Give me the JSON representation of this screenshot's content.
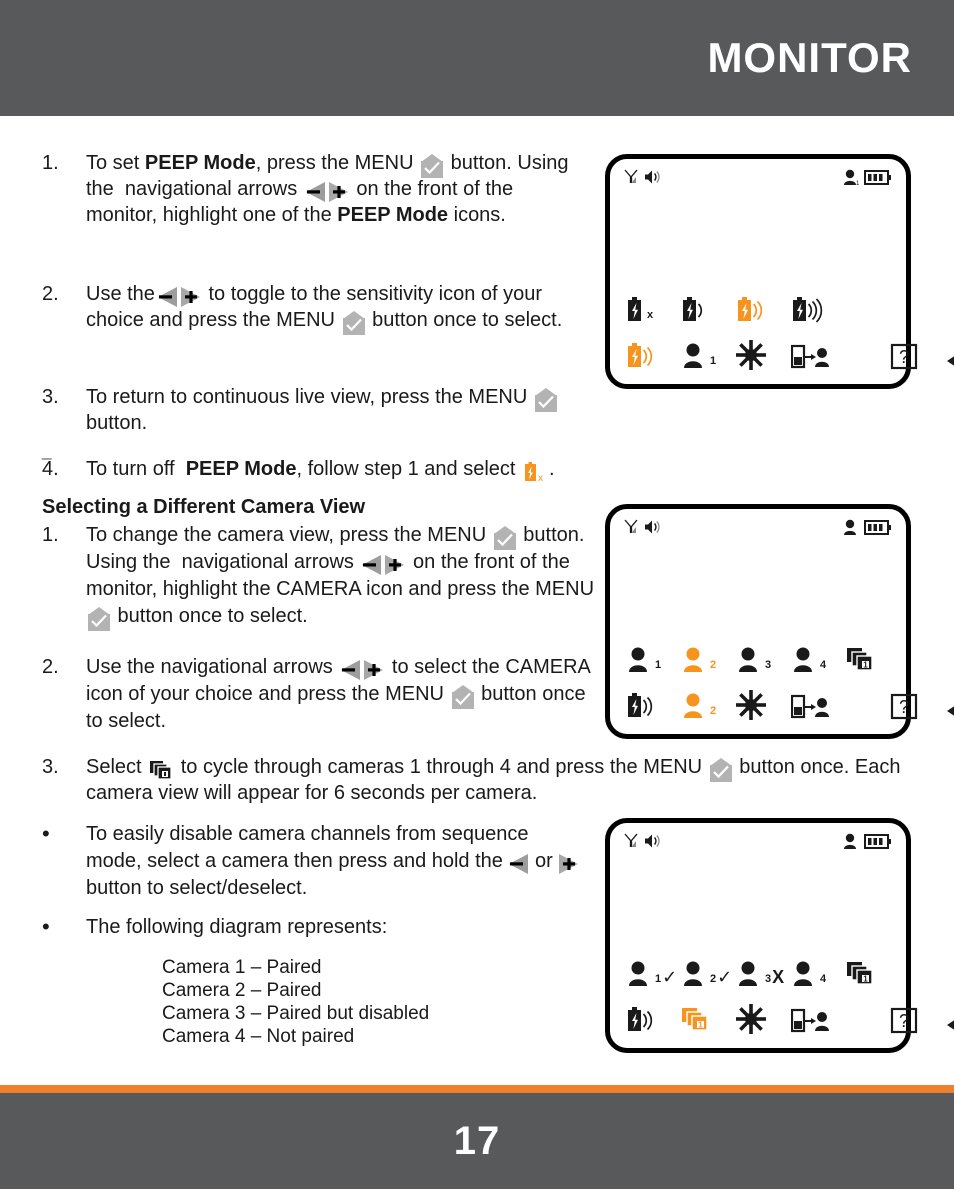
{
  "header": {
    "title": "MONITOR"
  },
  "footer": {
    "page_number": "17"
  },
  "colors": {
    "header_gray": "#58595b",
    "accent_orange": "#f07f2b",
    "icon_orange": "#f7941e",
    "icon_gray": "#b3b3b3",
    "black": "#000000"
  },
  "peep_section": {
    "steps": [
      {
        "marker": "1.",
        "parts": [
          {
            "t": "text",
            "v": "To set "
          },
          {
            "t": "bold",
            "v": "PEEP Mode"
          },
          {
            "t": "text",
            "v": ", press the MENU "
          },
          {
            "t": "icon",
            "v": "menu-check-icon"
          },
          {
            "t": "text",
            "v": " button. Using the  navigational arrows "
          },
          {
            "t": "icon",
            "v": "nav-arrows-icon"
          },
          {
            "t": "text",
            "v": " on the front of the monitor, highlight one of the "
          },
          {
            "t": "bold",
            "v": "PEEP Mode"
          },
          {
            "t": "text",
            "v": " icons."
          }
        ]
      },
      {
        "marker": "2.",
        "parts": [
          {
            "t": "text",
            "v": "Use the"
          },
          {
            "t": "icon",
            "v": "nav-arrows-icon"
          },
          {
            "t": "text",
            "v": " to toggle to the sensitivity icon of your choice and press the MENU "
          },
          {
            "t": "icon",
            "v": "menu-check-icon"
          },
          {
            "t": "text",
            "v": " button once to select."
          }
        ]
      },
      {
        "marker": "3.",
        "parts": [
          {
            "t": "text",
            "v": "To return to continuous live view, press the MENU "
          },
          {
            "t": "icon",
            "v": "menu-check-icon"
          },
          {
            "t": "text",
            "v": " button."
          }
        ]
      },
      {
        "marker": "4.",
        "parts": [
          {
            "t": "text",
            "v": "To turn off  "
          },
          {
            "t": "bold",
            "v": "PEEP Mode"
          },
          {
            "t": "text",
            "v": ", follow step 1 and select "
          },
          {
            "t": "icon",
            "v": "peep-off-battery-icon"
          },
          {
            "t": "text",
            "v": "."
          }
        ]
      }
    ],
    "stray_dash": "_"
  },
  "camera_section": {
    "heading": "Selecting a Different Camera View",
    "steps": [
      {
        "marker": "1.",
        "parts": [
          {
            "t": "text",
            "v": "To change the camera view, press the MENU "
          },
          {
            "t": "icon",
            "v": "menu-check-icon"
          },
          {
            "t": "text",
            "v": " button.  Using the  navigational arrows "
          },
          {
            "t": "icon",
            "v": "nav-arrows-icon"
          },
          {
            "t": "text",
            "v": " on the front of the monitor, highlight the CAMERA icon and press the MENU "
          },
          {
            "t": "icon",
            "v": "menu-check-icon"
          },
          {
            "t": "text",
            "v": " button once to select."
          }
        ]
      },
      {
        "marker": "2.",
        "parts": [
          {
            "t": "text",
            "v": "Use the navigational arrows "
          },
          {
            "t": "icon",
            "v": "nav-arrows-icon"
          },
          {
            "t": "text",
            "v": " to select the CAMERA icon of your choice and press the MENU "
          },
          {
            "t": "icon",
            "v": "menu-check-icon"
          },
          {
            "t": "text",
            "v": " button once to select."
          }
        ]
      },
      {
        "marker": "3.",
        "parts": [
          {
            "t": "text",
            "v": "Select "
          },
          {
            "t": "icon",
            "v": "sequence-icon"
          },
          {
            "t": "text",
            "v": " to cycle through cameras 1 through 4 and press the MENU "
          },
          {
            "t": "icon",
            "v": "menu-check-icon"
          },
          {
            "t": "text",
            "v": " button once. Each camera view will appear for 6 seconds per camera."
          }
        ]
      }
    ],
    "bullets": [
      {
        "marker": "•",
        "parts": [
          {
            "t": "text",
            "v": "To easily disable camera channels from sequence mode, select a camera then press and hold the "
          },
          {
            "t": "icon",
            "v": "arrow-left-icon"
          },
          {
            "t": "text",
            "v": " or "
          },
          {
            "t": "icon",
            "v": "arrow-right-icon"
          },
          {
            "t": "text",
            "v": " button to select/deselect."
          }
        ]
      },
      {
        "marker": "•",
        "parts": [
          {
            "t": "text",
            "v": "The following diagram represents:"
          }
        ]
      }
    ],
    "diagram_legend": [
      "Camera 1 – Paired",
      "Camera 2 – Paired",
      "Camera 3 – Paired but disabled",
      "Camera 4 – Not paired"
    ]
  },
  "monitors": [
    {
      "name": "peep-mode-screen",
      "status_left": [
        "signal-icon",
        "speaker-icon"
      ],
      "status_right": [
        "camera-icon",
        "battery-icon"
      ],
      "row1": [
        {
          "icon": "battery-bolt-icon",
          "color": "black",
          "sub": "x",
          "waves": 0
        },
        {
          "icon": "battery-bolt-icon",
          "color": "black",
          "sub": "",
          "waves": 1
        },
        {
          "icon": "battery-bolt-icon",
          "color": "orange",
          "sub": "",
          "waves": 2
        },
        {
          "icon": "battery-bolt-icon",
          "color": "black",
          "sub": "",
          "waves": 3
        }
      ],
      "row2": [
        {
          "icon": "battery-bolt-icon",
          "color": "orange",
          "sub": "",
          "waves": 2
        },
        {
          "icon": "camera-icon",
          "color": "black",
          "sub": "1"
        },
        {
          "icon": "brightness-icon",
          "color": "black",
          "sub": ""
        },
        {
          "icon": "pair-icon",
          "color": "black",
          "sub": ""
        },
        {
          "icon": "help-icon",
          "color": "black",
          "sub": ""
        },
        {
          "icon": "back-icon",
          "color": "black",
          "sub": ""
        }
      ]
    },
    {
      "name": "camera-select-screen",
      "status_left": [
        "signal-icon",
        "speaker-icon"
      ],
      "status_right": [
        "camera-icon",
        "battery-icon"
      ],
      "row1": [
        {
          "icon": "camera-icon",
          "color": "black",
          "sub": "1"
        },
        {
          "icon": "camera-icon",
          "color": "orange",
          "sub": "2"
        },
        {
          "icon": "camera-icon",
          "color": "black",
          "sub": "3"
        },
        {
          "icon": "camera-icon",
          "color": "black",
          "sub": "4"
        },
        {
          "icon": "sequence-icon",
          "color": "black",
          "sub": ""
        }
      ],
      "row2": [
        {
          "icon": "battery-bolt-icon",
          "color": "black",
          "sub": "",
          "waves": 2
        },
        {
          "icon": "camera-icon",
          "color": "orange",
          "sub": "2"
        },
        {
          "icon": "brightness-icon",
          "color": "black",
          "sub": ""
        },
        {
          "icon": "pair-icon",
          "color": "black",
          "sub": ""
        },
        {
          "icon": "help-icon",
          "color": "black",
          "sub": ""
        },
        {
          "icon": "back-icon",
          "color": "black",
          "sub": ""
        }
      ]
    },
    {
      "name": "sequence-status-screen",
      "status_left": [
        "signal-icon",
        "speaker-icon"
      ],
      "status_right": [
        "camera-icon",
        "battery-icon"
      ],
      "row1": [
        {
          "icon": "camera-icon",
          "color": "black",
          "sub": "1",
          "mark": "✓"
        },
        {
          "icon": "camera-icon",
          "color": "black",
          "sub": "2",
          "mark": "✓"
        },
        {
          "icon": "camera-icon",
          "color": "black",
          "sub": "3",
          "mark": "X"
        },
        {
          "icon": "camera-icon",
          "color": "black",
          "sub": "4",
          "mark": ""
        },
        {
          "icon": "sequence-icon",
          "color": "black",
          "sub": ""
        }
      ],
      "row2": [
        {
          "icon": "battery-bolt-icon",
          "color": "black",
          "sub": "",
          "waves": 2
        },
        {
          "icon": "sequence-icon",
          "color": "orange",
          "sub": ""
        },
        {
          "icon": "brightness-icon",
          "color": "black",
          "sub": ""
        },
        {
          "icon": "pair-icon",
          "color": "black",
          "sub": ""
        },
        {
          "icon": "help-icon",
          "color": "black",
          "sub": ""
        },
        {
          "icon": "back-icon",
          "color": "black",
          "sub": ""
        }
      ]
    }
  ]
}
